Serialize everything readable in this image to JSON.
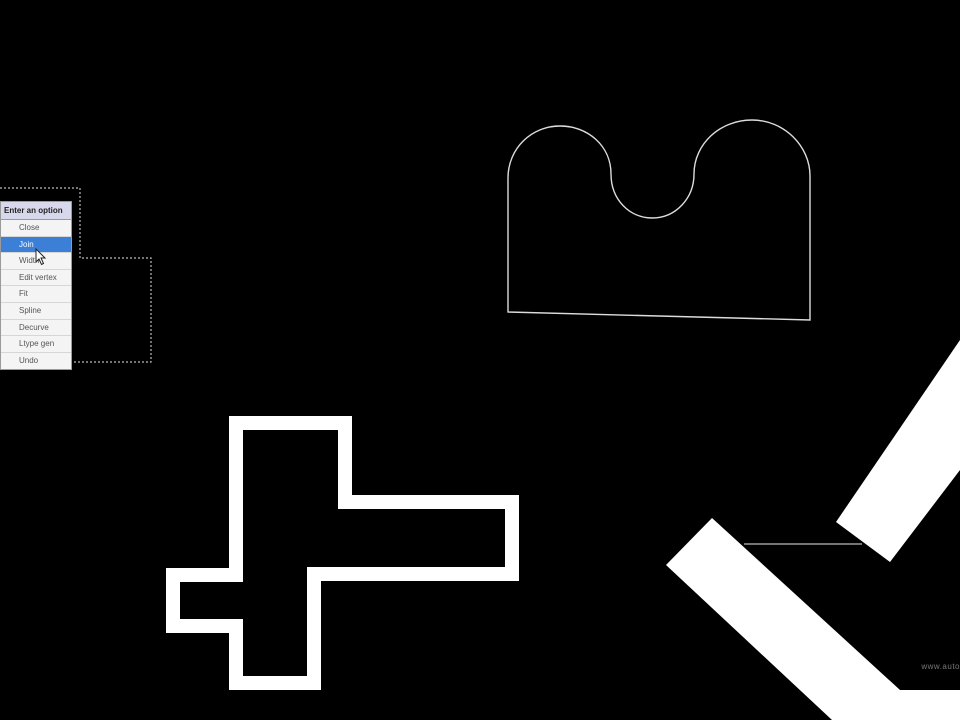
{
  "context_menu": {
    "title": "Enter an option",
    "items": [
      {
        "label": "Close",
        "selected": false
      },
      {
        "label": "Join",
        "selected": true
      },
      {
        "label": "Width",
        "selected": false
      },
      {
        "label": "Edit vertex",
        "selected": false
      },
      {
        "label": "Fit",
        "selected": false
      },
      {
        "label": "Spline",
        "selected": false
      },
      {
        "label": "Decurve",
        "selected": false
      },
      {
        "label": "Ltype gen",
        "selected": false
      },
      {
        "label": "Undo",
        "selected": false
      }
    ]
  },
  "watermark": "www.auto",
  "colors": {
    "background": "#000000",
    "lines": "#ffffff",
    "dashed_selection": "#bbbbbb",
    "menu_highlight": "#3c7fd6"
  },
  "icons": {
    "cursor": "arrow-hand-pointer-icon"
  }
}
